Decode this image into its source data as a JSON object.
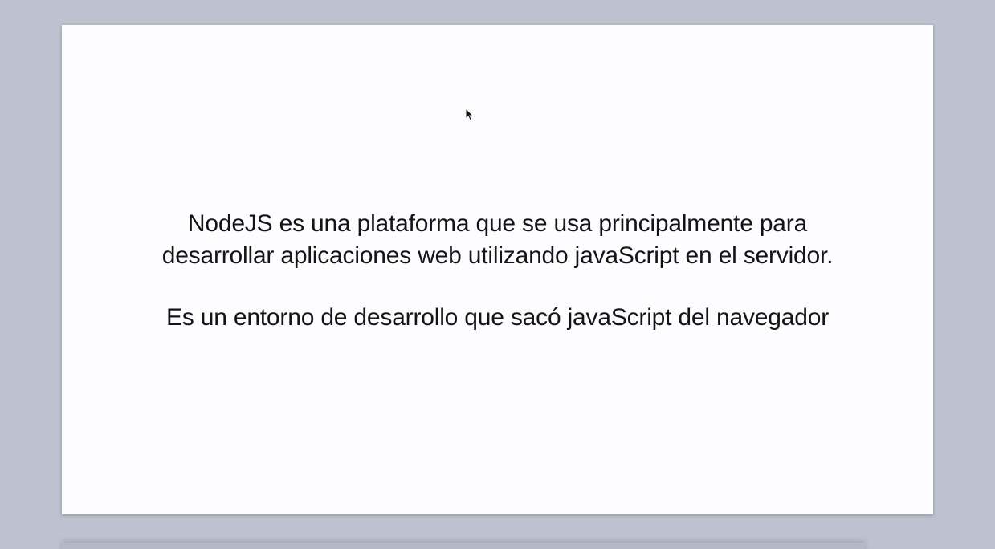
{
  "slide": {
    "paragraph1_line1": "NodeJS es una plataforma que se usa principalmente para",
    "paragraph1_line2": "desarrollar aplicaciones web utilizando javaScript en el servidor.",
    "paragraph2": "Es un entorno de desarrollo que sacó javaScript del navegador"
  },
  "colors": {
    "background": "#bcc2cf",
    "slide": "#fdfcfe",
    "text": "#141414"
  },
  "icons": {
    "cursor": "mouse-pointer-icon"
  }
}
